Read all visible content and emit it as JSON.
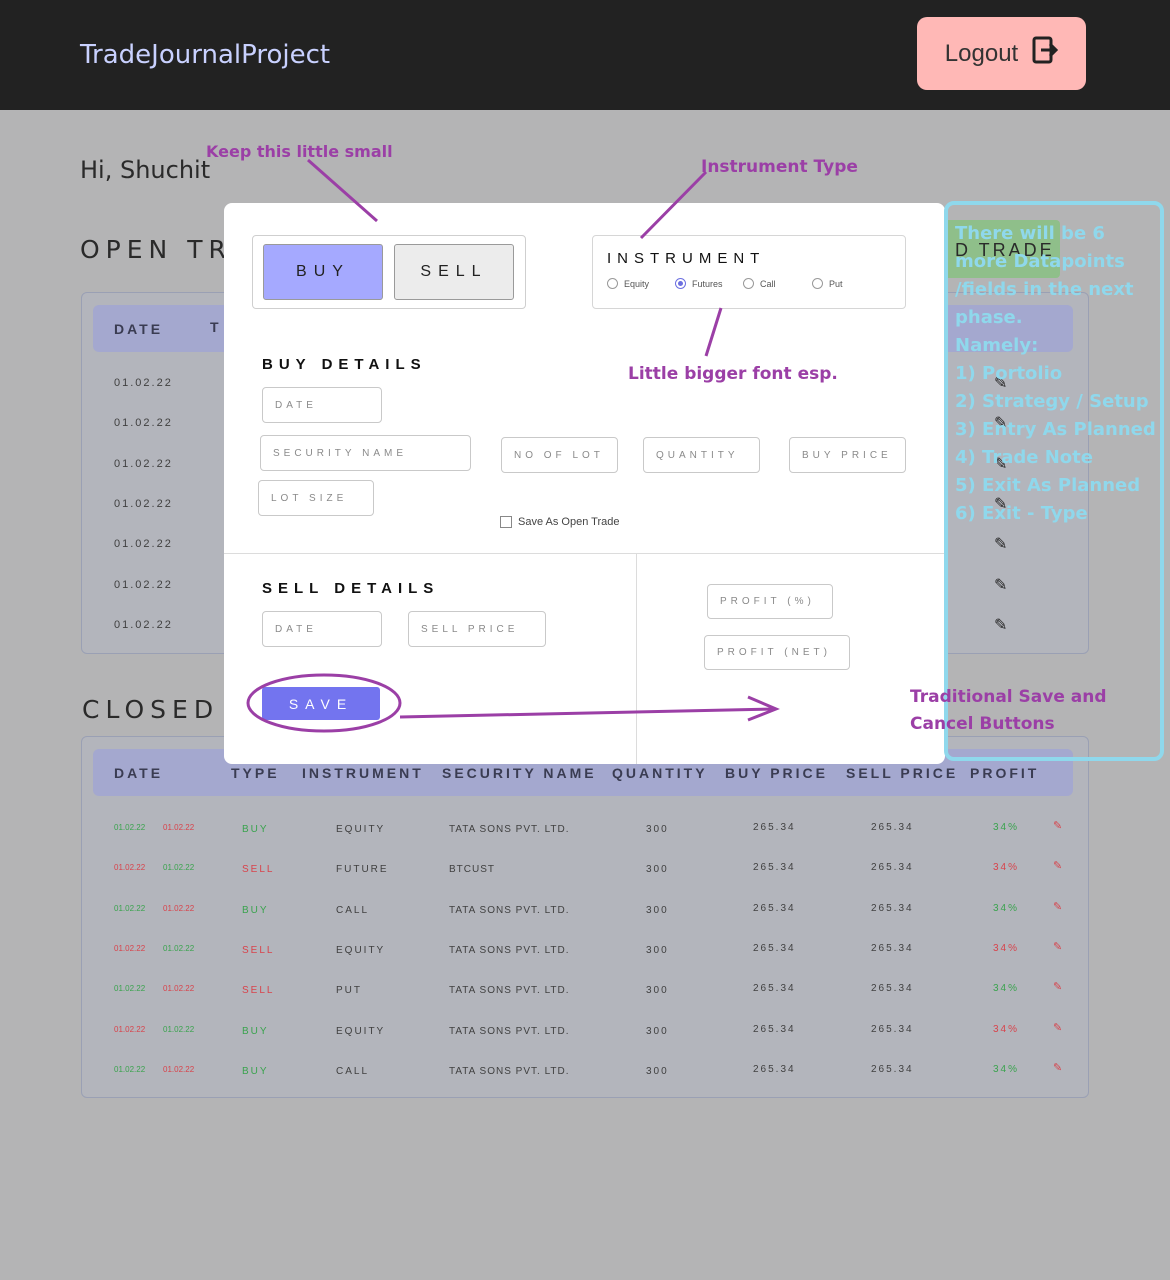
{
  "header": {
    "brand": "TradeJournalProject",
    "logout_label": "Logout"
  },
  "greeting": "Hi, Shuchit",
  "open_trades": {
    "title": "OPEN TR",
    "header_partial": [
      "DATE",
      "T"
    ],
    "dates": [
      "01.02.22",
      "01.02.22",
      "01.02.22",
      "01.02.22",
      "01.02.22",
      "01.02.22",
      "01.02.22"
    ]
  },
  "add_trade_partial": "D TRADE",
  "closed_trades": {
    "title": "CLOSED",
    "columns": [
      "DATE",
      "TYPE",
      "INSTRUMENT",
      "SECURITY NAME",
      "QUANTITY",
      "BUY PRICE",
      "SELL PRICE",
      "PROFIT"
    ],
    "rows": [
      {
        "d1": "01.02.22",
        "d2": "01.02.22",
        "type": "BUY",
        "instrument": "EQUITY",
        "security": "TATA SONS PVT. LTD.",
        "quantity": "300",
        "buy": "265.34",
        "sell": "265.34",
        "profit": "34%",
        "pos": true
      },
      {
        "d1": "01.02.22",
        "d2": "01.02.22",
        "type": "SELL",
        "instrument": "FUTURE",
        "security": "BTCUST",
        "quantity": "300",
        "buy": "265.34",
        "sell": "265.34",
        "profit": "34%",
        "pos": false
      },
      {
        "d1": "01.02.22",
        "d2": "01.02.22",
        "type": "BUY",
        "instrument": "CALL",
        "security": "TATA SONS PVT. LTD.",
        "quantity": "300",
        "buy": "265.34",
        "sell": "265.34",
        "profit": "34%",
        "pos": true
      },
      {
        "d1": "01.02.22",
        "d2": "01.02.22",
        "type": "SELL",
        "instrument": "EQUITY",
        "security": "TATA SONS PVT. LTD.",
        "quantity": "300",
        "buy": "265.34",
        "sell": "265.34",
        "profit": "34%",
        "pos": false
      },
      {
        "d1": "01.02.22",
        "d2": "01.02.22",
        "type": "SELL",
        "instrument": "PUT",
        "security": "TATA SONS PVT. LTD.",
        "quantity": "300",
        "buy": "265.34",
        "sell": "265.34",
        "profit": "34%",
        "pos": true
      },
      {
        "d1": "01.02.22",
        "d2": "01.02.22",
        "type": "BUY",
        "instrument": "EQUITY",
        "security": "TATA SONS PVT. LTD.",
        "quantity": "300",
        "buy": "265.34",
        "sell": "265.34",
        "profit": "34%",
        "pos": false
      },
      {
        "d1": "01.02.22",
        "d2": "01.02.22",
        "type": "BUY",
        "instrument": "CALL",
        "security": "TATA SONS PVT. LTD.",
        "quantity": "300",
        "buy": "265.34",
        "sell": "265.34",
        "profit": "34%",
        "pos": true
      }
    ]
  },
  "modal": {
    "buy_label": "BUY",
    "sell_label": "SELL",
    "instrument_label": "INSTRUMENT",
    "instrument_options": [
      "Equity",
      "Futures",
      "Call",
      "Put"
    ],
    "instrument_selected": "Futures",
    "buy_details_title": "BUY DETAILS",
    "buy_fields": {
      "date": "DATE",
      "security": "SECURITY NAME",
      "lots": "NO OF LOT",
      "quantity": "QUANTITY",
      "price": "BUY PRICE",
      "lot_size": "LOT SIZE"
    },
    "save_open_label": "Save As Open Trade",
    "sell_details_title": "SELL DETAILS",
    "sell_fields": {
      "date": "DATE",
      "price": "SELL PRICE"
    },
    "profit_pct": "PROFIT (%)",
    "profit_net": "PROFIT (NET)",
    "save_label": "SAVE"
  },
  "annotations": {
    "keep_small": "Keep this little small",
    "instrument_type": "Instrument Type",
    "bigger_font": "Little bigger font esp.",
    "traditional_1": "Traditional Save and",
    "traditional_2": "Cancel Buttons",
    "datapoints": [
      "There will be 6",
      "more Datapoints",
      "/fields in the next",
      "phase.",
      "Namely:",
      "1) Portolio",
      "2) Strategy / Setup",
      "3) Entry As Planned",
      "4) Trade Note",
      "5) Exit As Planned",
      "6) Exit - Type"
    ]
  },
  "colors": {
    "header": "#222222",
    "logout": "#ffb8b6",
    "buy_active": "#a5a9ff",
    "save": "#7374ef",
    "annotation": "#9b3fa6",
    "callout": "#8fd8ec"
  }
}
